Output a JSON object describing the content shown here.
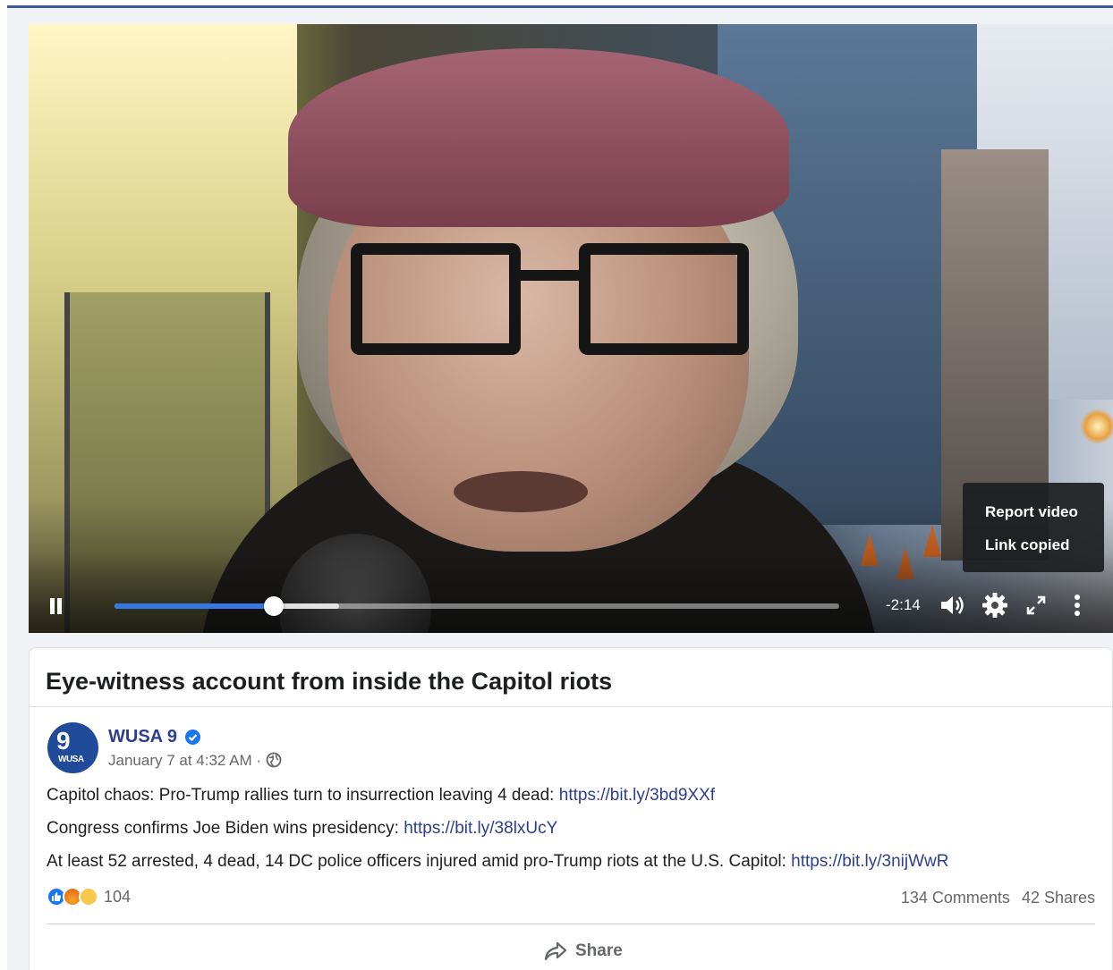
{
  "video": {
    "menu": {
      "report_label": "Report video",
      "link_copied_label": "Link copied"
    },
    "controls": {
      "time_remaining": "-2:14",
      "played_fraction": 0.22,
      "buffered_fraction": 0.31
    }
  },
  "card": {
    "title": "Eye-witness account from inside the Capitol riots"
  },
  "post": {
    "page_name": "WUSA 9",
    "avatar_text_big": "9",
    "avatar_text_small": "WUSA",
    "date": "January 7 at 4:32 AM",
    "meta_separator": " · ",
    "lines": [
      {
        "text": "Capitol chaos: Pro-Trump rallies turn to insurrection leaving 4 dead: ",
        "link": "https://bit.ly/3bd9XXf"
      },
      {
        "text": "Congress confirms Joe Biden wins presidency: ",
        "link": "https://bit.ly/38lxUcY"
      },
      {
        "text": "At least 52 arrested, 4 dead, 14 DC police officers injured amid pro-Trump riots at the U.S. Capitol: ",
        "link": "https://bit.ly/3nijWwR"
      }
    ],
    "reactions": {
      "count": "104",
      "types": [
        "like-icon",
        "angry-icon",
        "sad-icon"
      ]
    },
    "comments": "134 Comments",
    "shares": "42 Shares",
    "share_label": "Share"
  },
  "colors": {
    "accent": "#3578e5",
    "link": "#2c3e8f",
    "verified": "#1877f2"
  }
}
